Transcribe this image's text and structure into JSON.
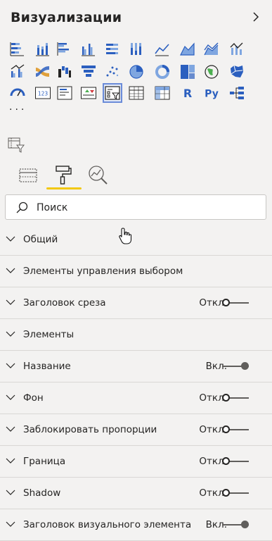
{
  "panel": {
    "title": "Визуализации",
    "collapse_icon": "chevron-right-icon"
  },
  "visualizations": [
    "stacked-bar-chart-icon",
    "stacked-column-chart-icon",
    "clustered-bar-chart-icon",
    "clustered-column-chart-icon",
    "100-stacked-bar-chart-icon",
    "100-stacked-column-chart-icon",
    "line-chart-icon",
    "area-chart-icon",
    "stacked-area-chart-icon",
    "line-and-stacked-column-chart-icon",
    "line-and-clustered-column-chart-icon",
    "ribbon-chart-icon",
    "waterfall-chart-icon",
    "funnel-chart-icon",
    "scatter-chart-icon",
    "pie-chart-icon",
    "donut-chart-icon",
    "treemap-icon",
    "map-icon",
    "filled-map-icon",
    "gauge-icon",
    "card-icon",
    "multi-row-card-icon",
    "kpi-icon",
    "slicer-icon",
    "table-icon",
    "matrix-icon",
    "r-script-visual-icon",
    "python-visual-icon",
    "decomposition-tree-icon"
  ],
  "viz_labels": {
    "card": "123",
    "r": "R",
    "python": "Py"
  },
  "more_label": "···",
  "tabs": [
    "fields-tab",
    "format-tab",
    "analytics-tab"
  ],
  "search": {
    "placeholder": "Поиск"
  },
  "accent_color": "#f2c811",
  "sections": [
    {
      "label": "Общий",
      "state": null
    },
    {
      "label": "Элементы управления выбором",
      "state": null
    },
    {
      "label": "Заголовок среза",
      "state": "Откл.",
      "on": false
    },
    {
      "label": "Элементы",
      "state": null
    },
    {
      "label": "Название",
      "state": "Вкл.",
      "on": true
    },
    {
      "label": "Фон",
      "state": "Откл.",
      "on": false
    },
    {
      "label": "Заблокировать пропорции",
      "state": "Откл.",
      "on": false
    },
    {
      "label": "Граница",
      "state": "Откл.",
      "on": false
    },
    {
      "label": "Shadow",
      "state": "Откл.",
      "on": false
    },
    {
      "label": "Заголовок визуального элемента",
      "state": "Вкл.",
      "on": true
    }
  ]
}
